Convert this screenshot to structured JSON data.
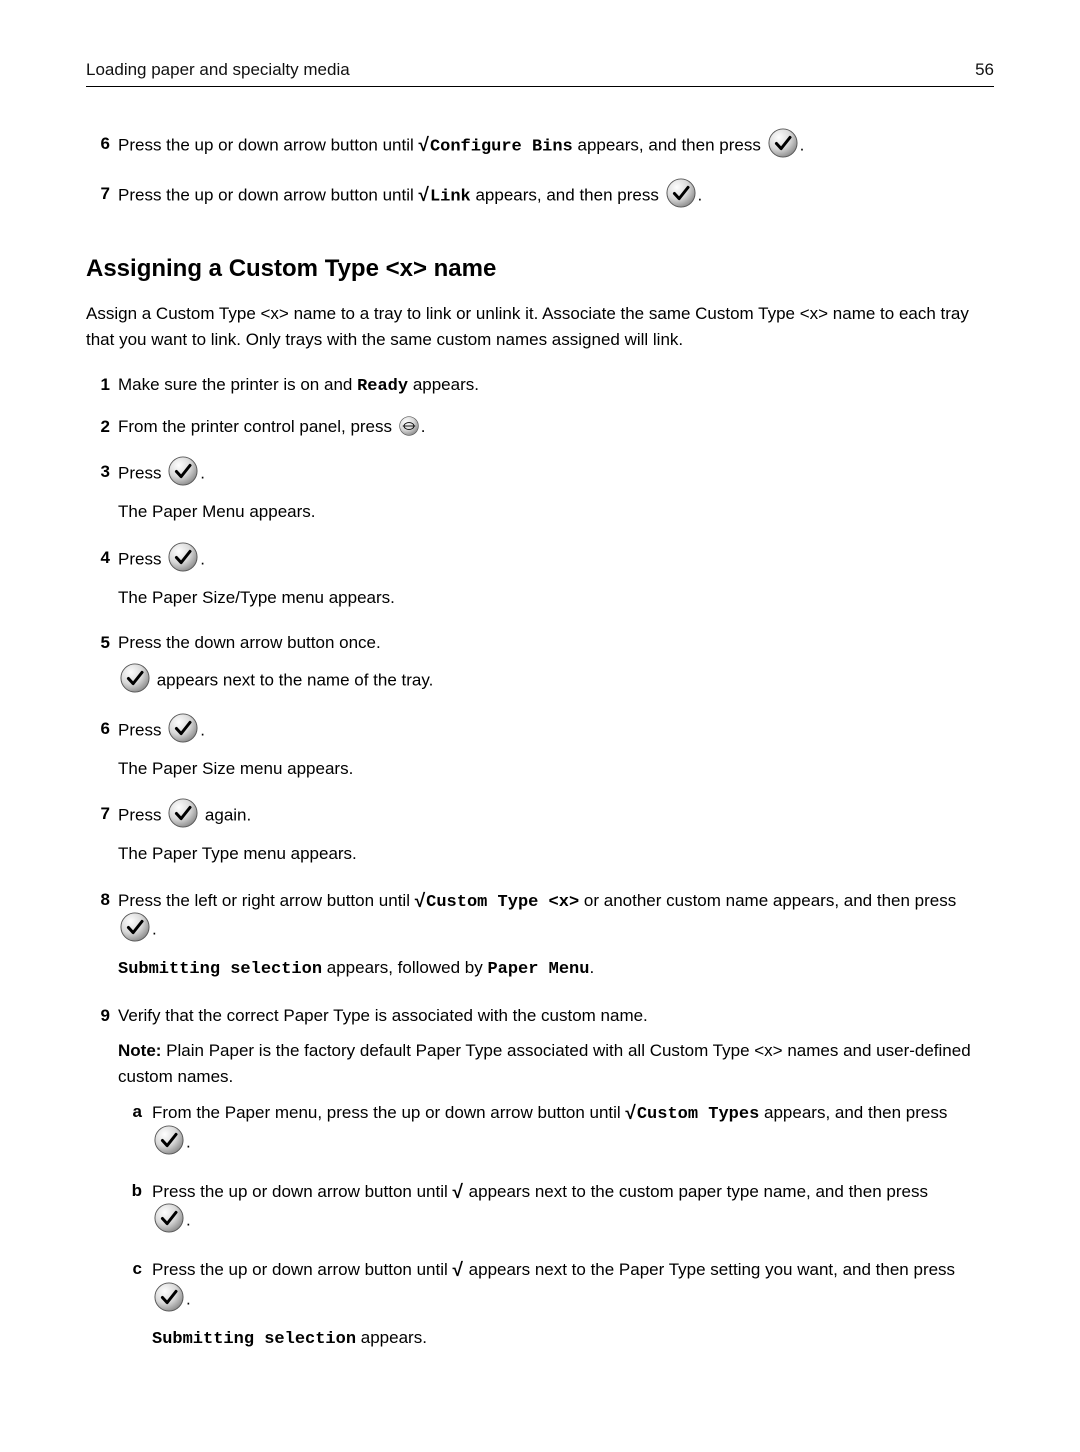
{
  "header": {
    "title": "Loading paper and specialty media",
    "page_number": "56"
  },
  "top_steps": {
    "s6": {
      "pre": "Press the up or down arrow button until ",
      "code": "Configure Bins",
      "mid": " appears, and then press ",
      "period": "."
    },
    "s7": {
      "pre": "Press the up or down arrow button until ",
      "code": "Link",
      "mid": " appears, and then press ",
      "period": "."
    }
  },
  "section_title": "Assigning a Custom Type <x> name",
  "intro": "Assign a Custom Type <x> name to a tray to link or unlink it. Associate the same Custom Type <x> name to each tray that you want to link. Only trays with the same custom names assigned will link.",
  "steps": {
    "s1": {
      "pre": "Make sure the printer is on and ",
      "code": "Ready",
      "post": " appears."
    },
    "s2": {
      "pre": "From the printer control panel, press ",
      "period": "."
    },
    "s3": {
      "pre": "Press ",
      "period": ".",
      "after": "The Paper Menu appears."
    },
    "s4": {
      "pre": "Press ",
      "period": ".",
      "after": "The Paper Size/Type menu appears."
    },
    "s5": {
      "line1": "Press the down arrow button once.",
      "line2_post": " appears next to the name of the tray."
    },
    "s6": {
      "pre": "Press ",
      "period": ".",
      "after": "The Paper Size menu appears."
    },
    "s7": {
      "pre": "Press ",
      "mid": " again.",
      "after": "The Paper Type menu appears."
    },
    "s8": {
      "pre": "Press the left or right arrow button until ",
      "code": "Custom Type <x>",
      "mid": " or another custom name appears, and then press ",
      "period": ".",
      "after_code1": "Submitting selection",
      "after_mid": " appears, followed by ",
      "after_code2": "Paper Menu",
      "after_period": "."
    },
    "s9": {
      "line1": "Verify that the correct Paper Type is associated with the custom name.",
      "note_label": "Note:",
      "note_body": " Plain Paper is the factory default Paper Type associated with all Custom Type <x> names and user-defined custom names.",
      "a": {
        "pre": "From the Paper menu, press the up or down arrow button until ",
        "code": "Custom Types",
        "mid": " appears, and then press ",
        "period": "."
      },
      "b": {
        "pre": "Press the up or down arrow button until ",
        "mid": " appears next to the custom paper type name, and then press ",
        "period": "."
      },
      "c": {
        "pre": "Press the up or down arrow button until ",
        "mid": " appears next to the Paper Type setting you want, and then press ",
        "period": ".",
        "after_code": "Submitting selection",
        "after_post": " appears."
      }
    }
  },
  "check_glyph": "√"
}
